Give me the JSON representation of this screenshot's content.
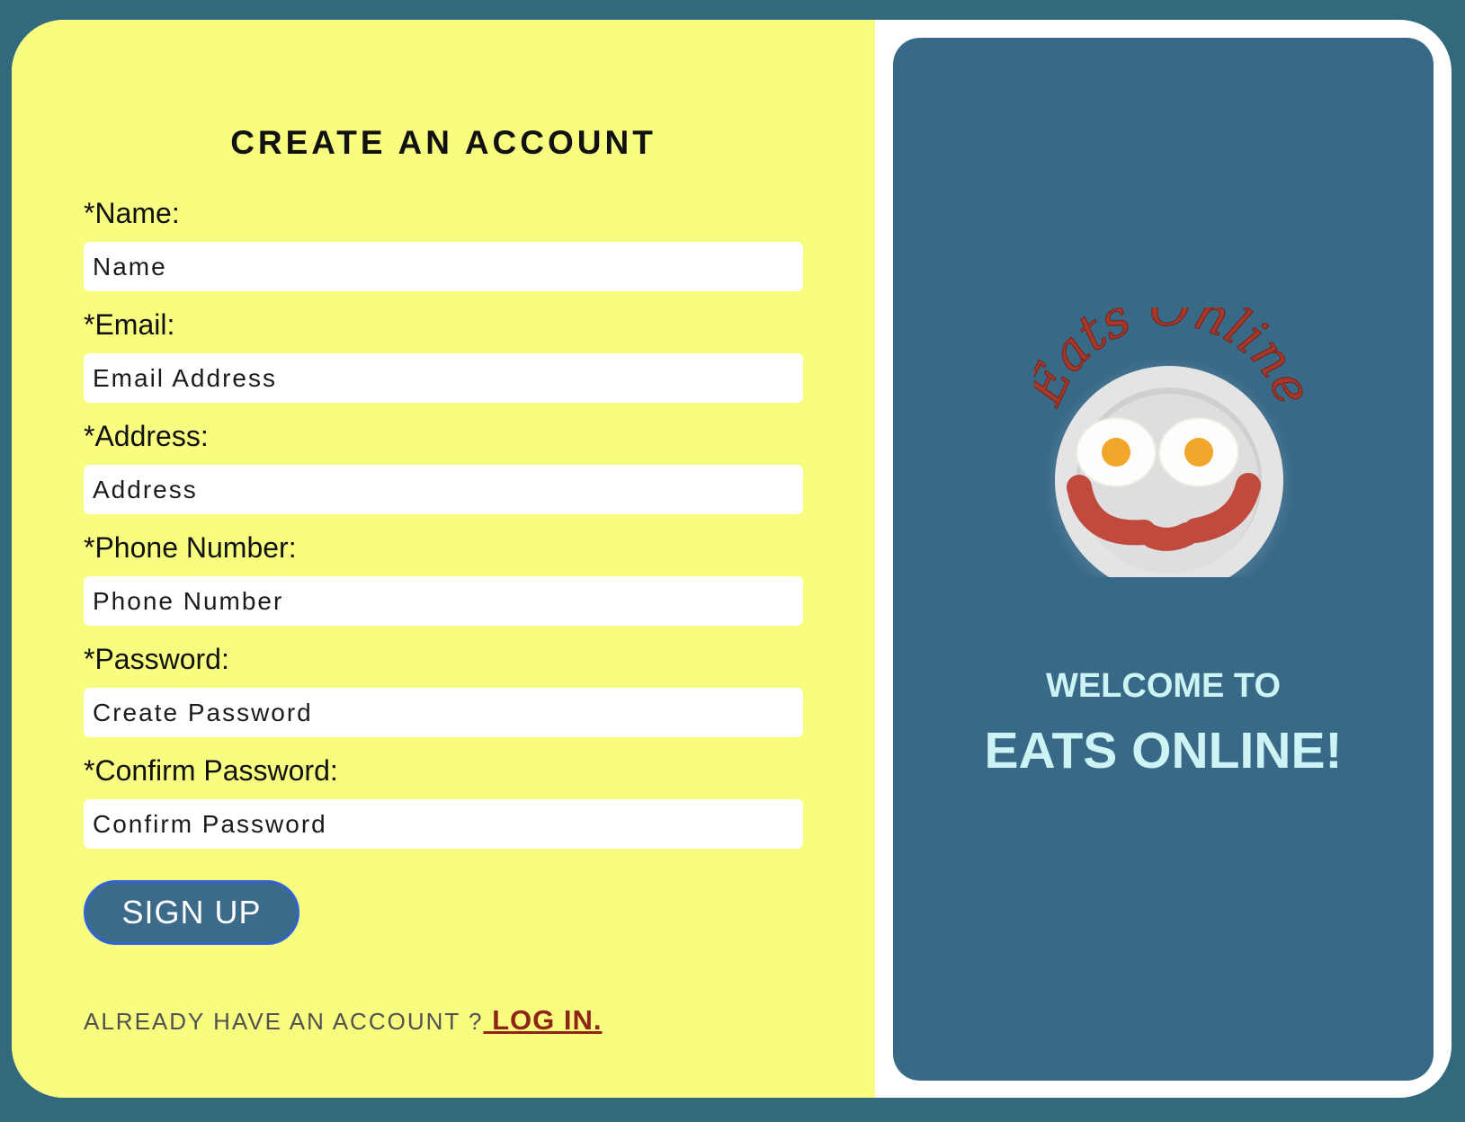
{
  "form": {
    "title": "CREATE AN ACCOUNT",
    "fields": [
      {
        "label": "*Name:",
        "placeholder": "Name"
      },
      {
        "label": "*Email:",
        "placeholder": "Email Address"
      },
      {
        "label": "*Address:",
        "placeholder": "Address"
      },
      {
        "label": "*Phone Number:",
        "placeholder": "Phone Number"
      },
      {
        "label": "*Password:",
        "placeholder": "Create Password"
      },
      {
        "label": "*Confirm Password:",
        "placeholder": "Confirm Password"
      }
    ],
    "signup_label": "SIGN UP",
    "login_prompt": "ALREADY HAVE AN ACCOUNT ?",
    "login_link": " LOG IN."
  },
  "welcome": {
    "logo_text": "Eats Online",
    "line1": "WELCOME TO",
    "line2": "EATS ONLINE!"
  },
  "colors": {
    "background": "#33697d",
    "form_panel": "#f8fd80",
    "welcome_panel": "#386987",
    "accent_red": "#8e2517",
    "welcome_text": "#cdf3f4"
  }
}
